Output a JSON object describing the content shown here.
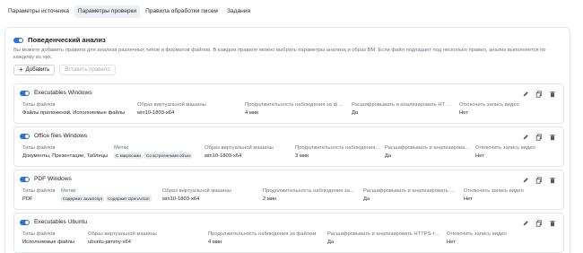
{
  "tabs": [
    {
      "label": "Параметры источника"
    },
    {
      "label": "Параметры проверки",
      "active": true
    },
    {
      "label": "Правила обработки писем"
    },
    {
      "label": "Задания"
    }
  ],
  "section": {
    "title": "Поведенческий анализ",
    "enabled": true,
    "description": "Вы можете добавить правила для анализа различных типов и форматов файлов. В каждом правиле можно выбрать параметры анализа и образ ВМ. Если файл подпадает под несколько правил, анализ выполняется по каждому из них."
  },
  "toolbar": {
    "add_label": "Добавить",
    "paste_label": "Вставить правило"
  },
  "labels": {
    "file_types": "Типы файлов",
    "tags": "Метки",
    "vm_image": "Образ виртуальной машины",
    "duration": "Продолжительность наблюдения за файлом",
    "decrypt": "Расшифровывать и анализировать HTTPS-трафик",
    "video_off": "Отключить запись видео"
  },
  "rules": [
    {
      "title": "Executables Windows",
      "file_types": "Файлы приложений, Исполняемые файлы",
      "tags": [],
      "vm_image": "win10-1803-x64",
      "duration": "4 мин",
      "decrypt": "Да",
      "video_off": "Нет"
    },
    {
      "title": "Office files Windows",
      "file_types": "Документы, Презентации, Таблицы",
      "tags": [
        "С макросами",
        "Со встроенными объек"
      ],
      "vm_image": "win10-1803-x64",
      "duration": "3 мин",
      "decrypt": "Да",
      "video_off": "Нет"
    },
    {
      "title": "PDF Windows",
      "file_types": "PDF",
      "tags": [
        "Содержит JavaScript",
        "Содержит OpenAction"
      ],
      "vm_image": "win10-1803-x64",
      "duration": "2 мин",
      "decrypt": "Да",
      "video_off": "Нет"
    },
    {
      "title": "Executables Ubuntu",
      "file_types": "Исполняемые файлы",
      "tags": [],
      "vm_image": "ubuntu-jammy-x64",
      "duration": "4 мин",
      "decrypt": "Да",
      "video_off": "Нет"
    }
  ]
}
